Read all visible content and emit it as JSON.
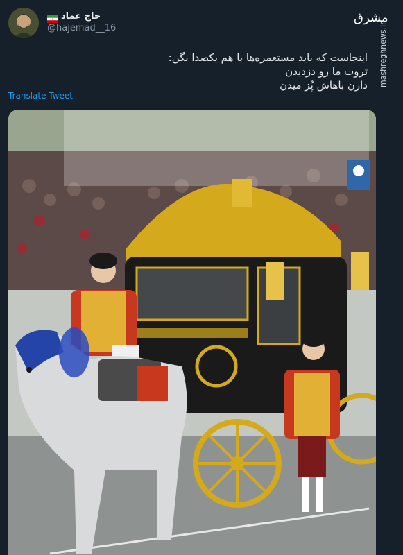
{
  "tweet": {
    "display_name": "حاج عماد",
    "handle": "@hajemad__16",
    "text_lines": [
      "اینجاست که باید مستعمره‌ها با هم یکصدا بگن:",
      "ثروت ما رو دزدیدن",
      "دارن باهاش پُز میدن"
    ],
    "translate_label": "Translate Tweet"
  },
  "branding": {
    "logo_text": "مشرق",
    "watermark": "mashreghnews.ir"
  },
  "colors": {
    "background": "#15202b",
    "link": "#1d9bf0",
    "muted": "#8b98a5",
    "coach_gold": "#d4a91c",
    "coach_black": "#1a1a1a",
    "livery_red": "#b3202a"
  },
  "icons": {
    "flag": "iran-flag-icon",
    "verified_logo": "mashregh-logo"
  }
}
